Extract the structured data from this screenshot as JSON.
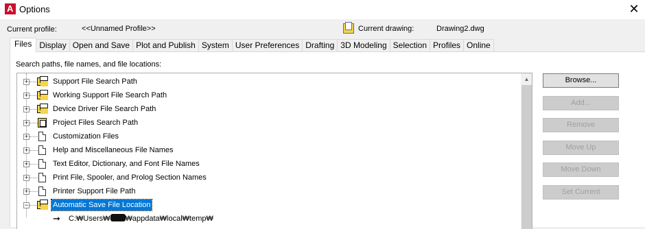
{
  "window": {
    "title": "Options",
    "close_glyph": "✕"
  },
  "profile": {
    "label": "Current profile:",
    "value": "<<Unnamed Profile>>"
  },
  "drawing": {
    "label": "Current drawing:",
    "value": "Drawing2.dwg"
  },
  "tabs": [
    "Files",
    "Display",
    "Open and Save",
    "Plot and Publish",
    "System",
    "User Preferences",
    "Drafting",
    "3D Modeling",
    "Selection",
    "Profiles",
    "Online"
  ],
  "active_tab": "Files",
  "panel": {
    "label": "Search paths, file names, and file locations:",
    "tree_items": [
      {
        "label": "Support File Search Path",
        "icon": "folder-icon",
        "expander": "+"
      },
      {
        "label": "Working Support File Search Path",
        "icon": "folder-icon",
        "expander": "+"
      },
      {
        "label": "Device Driver File Search Path",
        "icon": "folder-icon",
        "expander": "+"
      },
      {
        "label": "Project Files Search Path",
        "icon": "project-icon",
        "expander": "+"
      },
      {
        "label": "Customization Files",
        "icon": "file-icon",
        "expander": "+"
      },
      {
        "label": "Help and Miscellaneous File Names",
        "icon": "file-icon",
        "expander": "+"
      },
      {
        "label": "Text Editor, Dictionary, and Font File Names",
        "icon": "file-icon",
        "expander": "+"
      },
      {
        "label": "Print File, Spooler, and Prolog Section Names",
        "icon": "file-icon",
        "expander": "+"
      },
      {
        "label": "Printer Support File Path",
        "icon": "folder-icon",
        "expander": "+"
      },
      {
        "label": "Automatic Save File Location",
        "icon": "folder-icon",
        "expander": "−",
        "selected": true
      }
    ],
    "subpath": {
      "prefix": "C:₩Users₩",
      "suffix": "₩appdata₩local₩temp₩",
      "icon": "arrow-icon"
    }
  },
  "buttons": {
    "browse": "Browse...",
    "add": "Add...",
    "remove": "Remove",
    "move_up": "Move Up",
    "move_down": "Move Down",
    "set_current": "Set Current"
  },
  "colors": {
    "selection": "#0078d7",
    "folder": "#f5d547",
    "app_icon": "#c8102e"
  }
}
